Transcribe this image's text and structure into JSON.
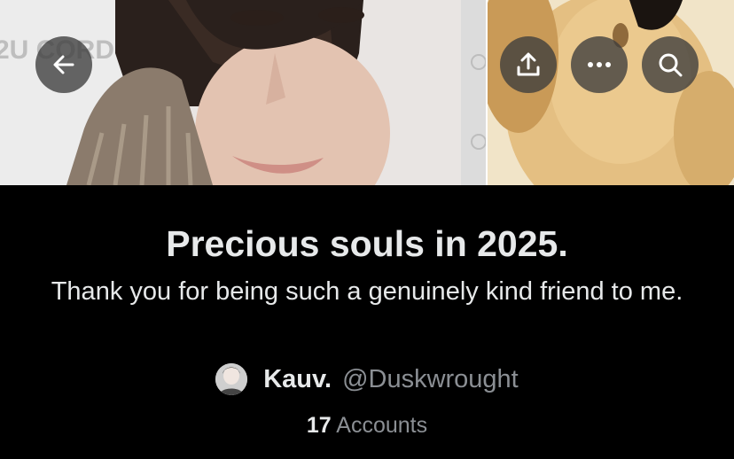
{
  "list": {
    "title": "Precious souls in 2025.",
    "description": "Thank you for being such a genuinely kind friend to me.",
    "owner_name": "Kauv.",
    "owner_handle": "@Duskwrought",
    "member_count": "17",
    "member_label": "Accounts"
  },
  "banner": {
    "left_image": "person-portrait-photo",
    "right_image": "plush-dog-photo",
    "background_text": "2U CORD"
  },
  "toolbar": {
    "back_icon": "arrow-left-icon",
    "share_icon": "share-icon",
    "more_icon": "more-icon",
    "search_icon": "search-icon"
  },
  "colors": {
    "background": "#000000",
    "primary_text": "#e7e9ea",
    "secondary_text": "#8b8f94",
    "button_bg": "rgba(60,60,60,0.78)"
  }
}
